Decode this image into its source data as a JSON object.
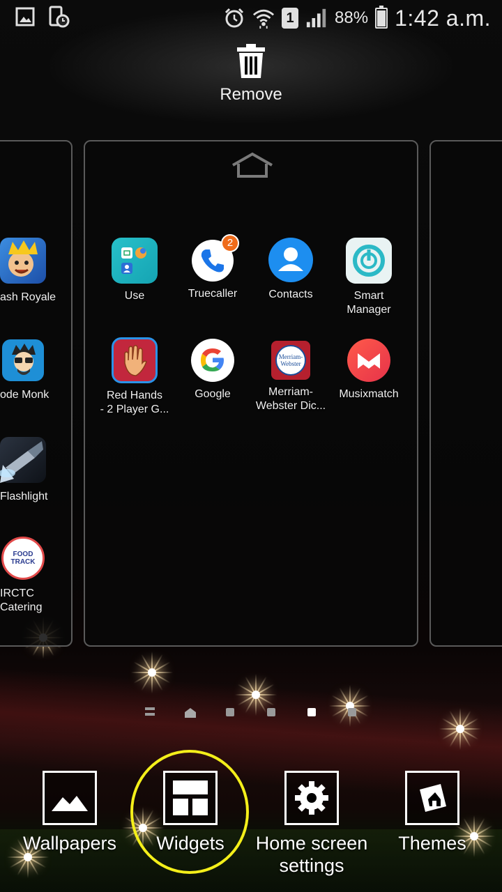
{
  "status_bar": {
    "battery": "88%",
    "time": "1:42 a.m.",
    "sim_slot": "1",
    "icons": [
      "gallery-icon",
      "screen-timer-icon",
      "alarm-icon",
      "wifi-icon",
      "sim-icon",
      "signal-icon",
      "battery-icon"
    ]
  },
  "remove": {
    "label": "Remove",
    "icon": "trash-icon"
  },
  "left_panel_apps": [
    {
      "label": "ash Royale",
      "icon": "clash-royale-icon"
    },
    {
      "label": "ode Monk",
      "icon": "code-monk-icon"
    },
    {
      "label": "Flashlight",
      "icon": "flashlight-icon"
    },
    {
      "label": "IRCTC\nCatering",
      "label_line1": "IRCTC",
      "label_line2": "Catering",
      "icon": "irctc-catering-icon",
      "logo_text": "FOOD TRACK"
    }
  ],
  "center_panel": {
    "home_icon": "home-outline-icon",
    "apps": [
      {
        "label": "Use",
        "icon": "folder-use-icon"
      },
      {
        "label": "Truecaller",
        "icon": "truecaller-icon",
        "badge": "2"
      },
      {
        "label": "Contacts",
        "icon": "contacts-icon"
      },
      {
        "label_line1": "Smart",
        "label_line2": "Manager",
        "icon": "smart-manager-icon"
      },
      {
        "label_line1": "Red Hands",
        "label_line2": "- 2 Player G...",
        "icon": "red-hands-icon"
      },
      {
        "label": "Google",
        "icon": "google-icon"
      },
      {
        "label_line1": "Merriam-",
        "label_line2": "Webster Dic...",
        "icon": "merriam-webster-icon",
        "logo_line1": "Merriam-",
        "logo_line2": "Webster"
      },
      {
        "label": "Musixmatch",
        "icon": "musixmatch-icon"
      }
    ]
  },
  "page_indicator": {
    "count": 6,
    "active_index": 4
  },
  "options": [
    {
      "label": "Wallpapers",
      "icon": "wallpapers-icon"
    },
    {
      "label": "Widgets",
      "icon": "widgets-icon",
      "highlighted": true
    },
    {
      "label_line1": "Home screen",
      "label_line2": "settings",
      "icon": "settings-gear-icon"
    },
    {
      "label": "Themes",
      "icon": "themes-icon"
    }
  ],
  "colors": {
    "highlight_ring": "#f4ef1a",
    "badge": "#ef6b1a",
    "panel_border": "#5a5a5a"
  }
}
